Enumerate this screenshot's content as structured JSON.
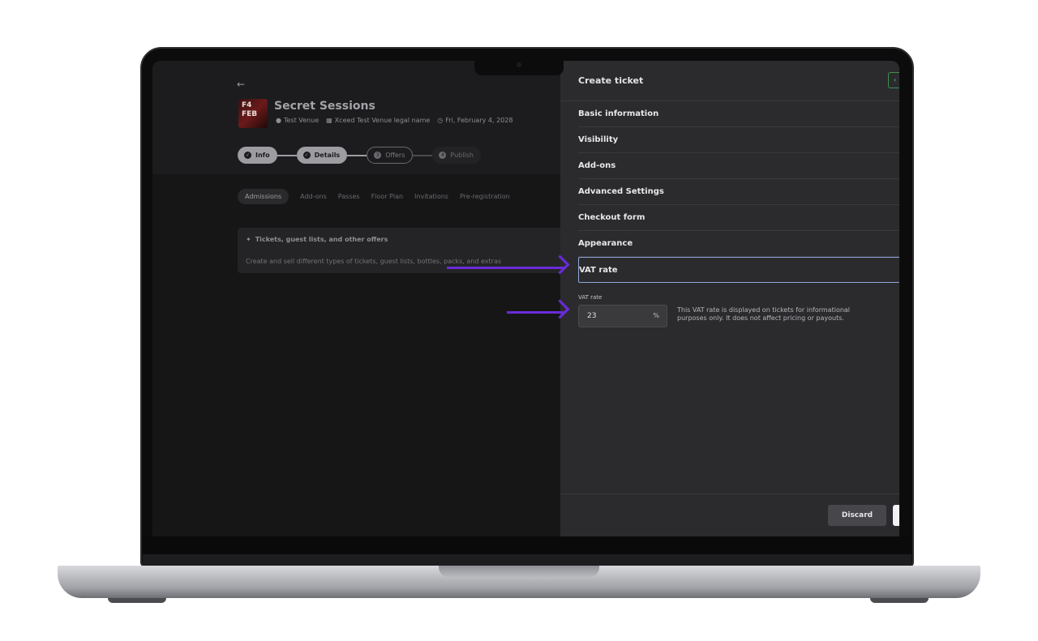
{
  "event": {
    "back_icon": "arrow-left-icon",
    "thumb_text": "F4\nFEB",
    "title": "Secret Sessions",
    "venue": "Test Venue",
    "legal_name": "Xceed Test Venue legal name",
    "date": "Fri, February 4, 2028"
  },
  "steps": [
    {
      "label": "Info",
      "state": "done"
    },
    {
      "label": "Details",
      "state": "done"
    },
    {
      "label": "Offers",
      "number": "3",
      "state": "active"
    },
    {
      "label": "Publish",
      "number": "4",
      "state": "todo"
    }
  ],
  "tabs": [
    "Admissions",
    "Add-ons",
    "Passes",
    "Floor Plan",
    "Invitations",
    "Pre-registration"
  ],
  "offer_card": {
    "title": "Tickets, guest lists, and other offers",
    "description": "Create and sell different types of tickets, guest lists, bottles, packs, and extras"
  },
  "panel": {
    "title": "Create ticket",
    "sections": [
      "Basic information",
      "Visibility",
      "Add-ons",
      "Advanced Settings",
      "Checkout form",
      "Appearance",
      "VAT rate"
    ],
    "vat": {
      "label": "VAT rate",
      "value": "23",
      "suffix": "%",
      "help": "This VAT rate is displayed on tickets for informational purposes only. It does not affect pricing or payouts."
    },
    "discard_label": "Discard"
  },
  "colors": {
    "accent_arrow": "#6a2bd9",
    "panel_bg": "#2b2b2e",
    "focus_border": "#8fa6d6"
  }
}
